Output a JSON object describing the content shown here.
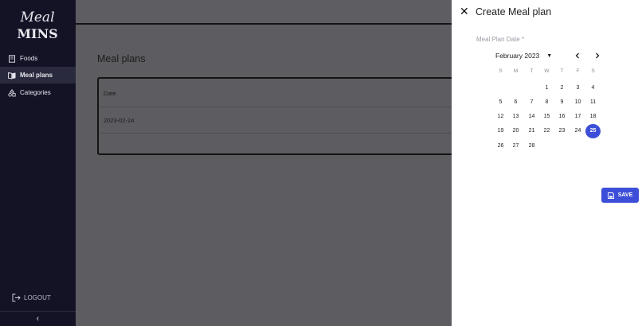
{
  "sidebar": {
    "logo_text": "Meal MINS",
    "items": [
      {
        "label": "Foods",
        "icon": "book-icon"
      },
      {
        "label": "Meal plans",
        "icon": "menu-book-icon"
      },
      {
        "label": "Categories",
        "icon": "category-icon"
      }
    ],
    "logout_label": "LOGOUT",
    "collapse_glyph": "‹"
  },
  "main": {
    "title": "Meal plans",
    "table": {
      "header": "Date",
      "rows": [
        "2023-02-24"
      ]
    }
  },
  "drawer": {
    "close_glyph": "✕",
    "title": "Create Meal plan",
    "field_label": "Meal Plan Date *",
    "calendar": {
      "month_label": "February 2023",
      "weekdays": [
        "S",
        "M",
        "T",
        "W",
        "T",
        "F",
        "S"
      ],
      "weeks": [
        [
          "",
          "",
          "",
          "1",
          "2",
          "3",
          "4"
        ],
        [
          "5",
          "6",
          "7",
          "8",
          "9",
          "10",
          "11"
        ],
        [
          "12",
          "13",
          "14",
          "15",
          "16",
          "17",
          "18"
        ],
        [
          "19",
          "20",
          "21",
          "22",
          "23",
          "24",
          "25"
        ],
        [
          "26",
          "27",
          "28",
          "",
          "",
          "",
          ""
        ]
      ],
      "selected_day": "25"
    },
    "save_label": "SAVE"
  },
  "colors": {
    "accent": "#3d4fd8",
    "sidebar_bg": "#141326"
  }
}
